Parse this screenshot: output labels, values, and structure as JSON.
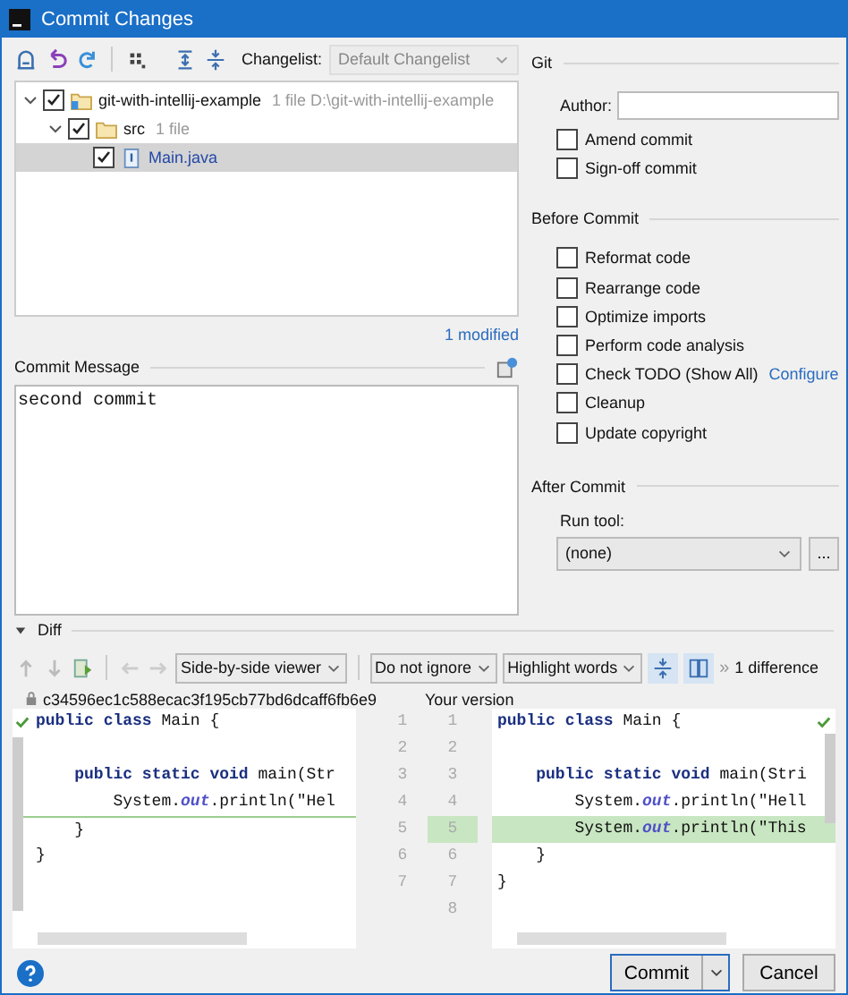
{
  "window": {
    "title": "Commit Changes"
  },
  "changes_toolbar": {
    "changelist_label": "Changelist:",
    "changelist_value": "Default Changelist"
  },
  "tree": [
    {
      "name": "git-with-intellij-example",
      "detail": "1 file D:\\git-with-intellij-example",
      "kind": "module",
      "checked": true,
      "selected": false,
      "modified": false,
      "expanded": true,
      "children": [
        {
          "name": "src",
          "detail": "1 file",
          "kind": "folder",
          "checked": true,
          "selected": false,
          "modified": false,
          "expanded": true,
          "children": [
            {
              "name": "Main.java",
              "kind": "file",
              "checked": true,
              "selected": true,
              "modified": true
            }
          ]
        }
      ]
    }
  ],
  "changes_summary": "1 modified",
  "commit_message": {
    "label": "Commit Message",
    "value": "second commit"
  },
  "git": {
    "heading": "Git",
    "author_label": "Author:",
    "options": [
      {
        "label": "Amend commit",
        "checked": false
      },
      {
        "label": "Sign-off commit",
        "checked": false
      }
    ]
  },
  "before_commit": {
    "heading": "Before Commit",
    "options": [
      {
        "label": "Reformat code",
        "checked": false
      },
      {
        "label": "Rearrange code",
        "checked": false
      },
      {
        "label": "Optimize imports",
        "checked": false
      },
      {
        "label": "Perform code analysis",
        "checked": false
      },
      {
        "label": "Check TODO (Show All)",
        "checked": false,
        "link": "Configure"
      },
      {
        "label": "Cleanup",
        "checked": false
      },
      {
        "label": "Update copyright",
        "checked": false
      }
    ]
  },
  "after_commit": {
    "heading": "After Commit",
    "run_tool_label": "Run tool:",
    "run_tool_value": "(none)",
    "more_button": "..."
  },
  "diff": {
    "heading": "Diff",
    "expanded": true,
    "viewer": "Side-by-side viewer",
    "ignore": "Do not ignore",
    "highlight": "Highlight words",
    "difference_count": "1 difference",
    "overflow_chevron": "»",
    "left_title": "c34596ec1c588ecac3f195cb77bd6dcaff6fb6e9",
    "right_title": "Your version",
    "left_lines": [
      {
        "number": "1",
        "text": "**public** **class** Main {",
        "kind": "same"
      },
      {
        "number": "2",
        "kind": "same"
      },
      {
        "number": "3",
        "text": "    **public** **static** **void** main(Str",
        "kind": "same"
      },
      {
        "number": "4",
        "text": "        System.*out*.println(\"Hel",
        "kind": "same"
      },
      {
        "number": "5",
        "text": "    }",
        "kind": "insert_point"
      },
      {
        "number": "6",
        "text": "}",
        "kind": "same"
      },
      {
        "number": "7",
        "kind": "same"
      }
    ],
    "right_lines": [
      {
        "number": "1",
        "text": "**public** **class** Main {",
        "kind": "same"
      },
      {
        "number": "2",
        "kind": "same"
      },
      {
        "number": "3",
        "text": "    **public** **static** **void** main(Stri",
        "kind": "same"
      },
      {
        "number": "4",
        "text": "        System.*out*.println(\"Hell",
        "kind": "same"
      },
      {
        "number": "5",
        "text": "        System.*out*.println(\"This",
        "kind": "added"
      },
      {
        "number": "6",
        "text": "    }",
        "kind": "same"
      },
      {
        "number": "7",
        "text": "}",
        "kind": "same"
      },
      {
        "number": "8",
        "kind": "same"
      }
    ]
  },
  "buttons": {
    "commit": "Commit",
    "cancel": "Cancel"
  }
}
